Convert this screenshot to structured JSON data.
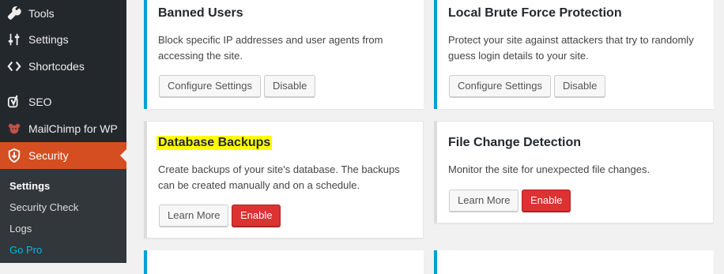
{
  "sidebar": {
    "items": [
      {
        "label": "Tools",
        "icon": "wrench-icon"
      },
      {
        "label": "Settings",
        "icon": "settings-sliders-icon"
      },
      {
        "label": "Shortcodes",
        "icon": "code-brackets-icon"
      },
      {
        "label": "SEO",
        "icon": "yoast-icon"
      },
      {
        "label": "MailChimp for WP",
        "icon": "mailchimp-icon"
      },
      {
        "label": "Security",
        "icon": "shield-icon",
        "active": true
      }
    ],
    "submenu": [
      {
        "label": "Settings",
        "current": true
      },
      {
        "label": "Security Check"
      },
      {
        "label": "Logs"
      },
      {
        "label": "Go Pro"
      }
    ],
    "active_color": "#d54e21"
  },
  "cards": {
    "banned_users": {
      "title": "Banned Users",
      "description": "Block specific IP addresses and user agents from accessing the site.",
      "buttons": [
        "Configure Settings",
        "Disable"
      ]
    },
    "local_brute_force": {
      "title": "Local Brute Force Protection",
      "description": "Protect your site against attackers that try to randomly guess login details to your site.",
      "buttons": [
        "Configure Settings",
        "Disable"
      ]
    },
    "database_backups": {
      "title": "Database Backups",
      "description": "Create backups of your site's database. The backups can be created manually and on a schedule.",
      "buttons": [
        "Learn More",
        "Enable"
      ]
    },
    "file_change_detection": {
      "title": "File Change Detection",
      "description": "Monitor the site for unexpected file changes.",
      "buttons": [
        "Learn More",
        "Enable"
      ]
    }
  },
  "colors": {
    "accent_blue": "#00a0d2",
    "enable_red": "#dc3232",
    "highlight_yellow": "#ffff00"
  }
}
